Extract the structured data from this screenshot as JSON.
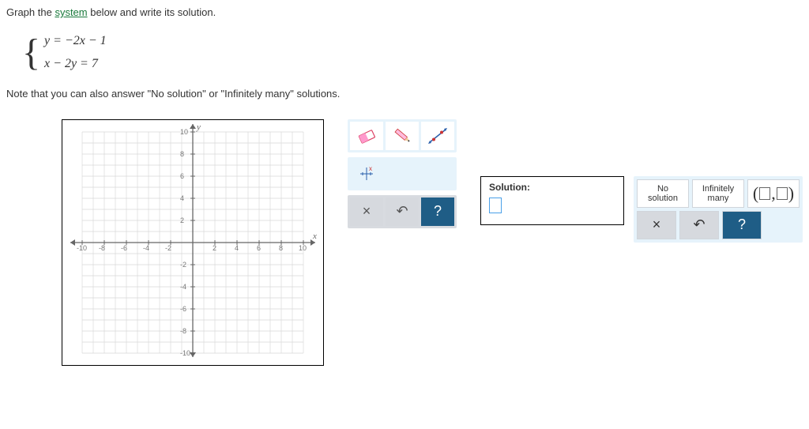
{
  "prompt": {
    "pre": "Graph the ",
    "link": "system",
    "post": " below and write its solution."
  },
  "equations": {
    "eq1": "y = −2x − 1",
    "eq2": "x − 2y = 7"
  },
  "note": "Note that you can also answer \"No solution\" or \"Infinitely many\" solutions.",
  "chart_data": {
    "type": "scatter",
    "title": "",
    "xlabel": "x",
    "ylabel": "y",
    "xlim": [
      -11,
      11
    ],
    "ylim": [
      -11,
      11
    ],
    "xticks": [
      -10,
      -8,
      -6,
      -4,
      -2,
      2,
      4,
      6,
      8,
      10
    ],
    "yticks": [
      -10,
      -8,
      -6,
      -4,
      -2,
      2,
      4,
      6,
      8,
      10
    ],
    "series": []
  },
  "tools": {
    "eraser": "eraser",
    "pencil": "pencil",
    "line": "line",
    "point": "point",
    "clear": "×",
    "undo": "↶",
    "help": "?"
  },
  "solution": {
    "label": "Solution:"
  },
  "right": {
    "no_solution": "No\nsolution",
    "inf_many": "Infinitely\nmany",
    "clear": "×",
    "undo": "↶",
    "help": "?"
  }
}
